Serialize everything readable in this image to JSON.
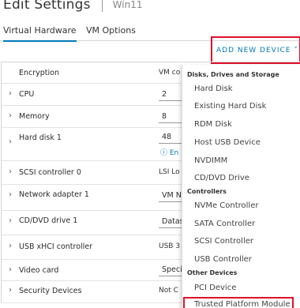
{
  "header": {
    "title": "Edit Settings",
    "vm_name": "Win11"
  },
  "tabs": [
    {
      "label": "Virtual Hardware",
      "active": true
    },
    {
      "label": "VM Options",
      "active": false
    }
  ],
  "add_device_label": "ADD NEW DEVICE ˅",
  "rows": [
    {
      "label": "Encryption",
      "value": "VM co",
      "expandable": false
    },
    {
      "label": "CPU",
      "value": "2",
      "expandable": true
    },
    {
      "label": "Memory",
      "value": "8",
      "expandable": true
    },
    {
      "label": "Hard disk 1",
      "value": "48",
      "info": "ⓘ En",
      "expandable": true
    },
    {
      "label": "SCSI controller 0",
      "value": "LSI Lo",
      "expandable": true
    },
    {
      "label": "Network adapter 1",
      "value": "VM N",
      "expandable": true
    },
    {
      "label": "CD/DVD drive 1",
      "value": "Datas",
      "expandable": true
    },
    {
      "label": "USB xHCI controller",
      "value": "USB 3",
      "expandable": true
    },
    {
      "label": "Video card",
      "value": "Speci",
      "expandable": true
    },
    {
      "label": "Security Devices",
      "value": "Not C",
      "expandable": true
    }
  ],
  "menu": {
    "groups": [
      {
        "heading": "Disks, Drives and Storage",
        "items": [
          "Hard Disk",
          "Existing Hard Disk",
          "RDM Disk",
          "Host USB Device",
          "NVDIMM",
          "CD/DVD Drive"
        ]
      },
      {
        "heading": "Controllers",
        "items": [
          "NVMe Controller",
          "SATA Controller",
          "SCSI Controller",
          "USB Controller"
        ]
      },
      {
        "heading": "Other Devices",
        "items": [
          "PCI Device",
          "Trusted Platform Module"
        ]
      }
    ]
  },
  "colors": {
    "accent": "#0079b8",
    "highlight": "#e0112b"
  }
}
